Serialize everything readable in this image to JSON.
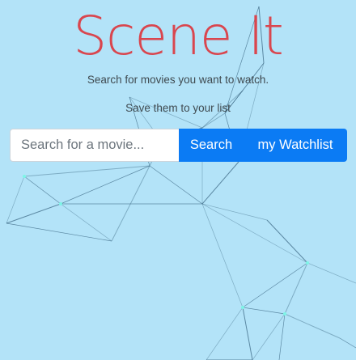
{
  "app": {
    "title": "Scene It",
    "subtitle_1": "Search for movies you want to watch.",
    "subtitle_2": "Save them to your list"
  },
  "search": {
    "placeholder": "Search for a movie...",
    "value": "",
    "button_label": "Search"
  },
  "watchlist_button": {
    "label": "my Watchlist"
  },
  "colors": {
    "background": "#b3e3f8",
    "title": "#d9464e",
    "button": "#0b7bf4",
    "network_line": "#3d6a86",
    "network_node": "#7df5e6"
  }
}
